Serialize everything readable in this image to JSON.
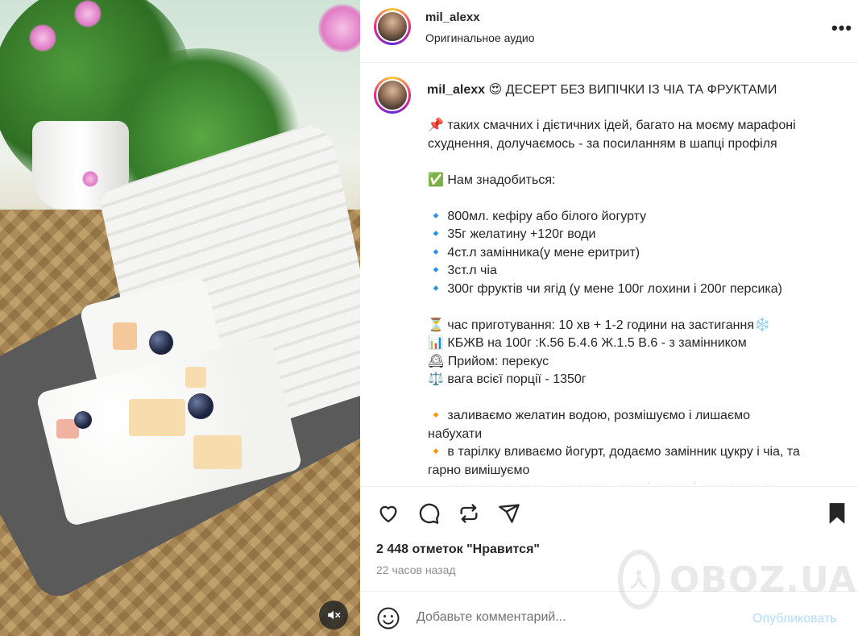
{
  "post": {
    "username": "mil_alexx",
    "audio_label": "Оригинальное аудио",
    "more_glyph": "•••"
  },
  "caption": {
    "username": "mil_alexx",
    "title": "😍 ДЕСЕРТ БЕЗ ВИПІЧКИ ІЗ ЧІА ТА ФРУКТАМИ",
    "lines": [
      "📌 таких смачних і дієтичних ідей, багато на моєму марафоні",
      "схуднення, долучаємось - за посиланням в шапці профіля",
      "",
      "✅ Нам знадобиться:",
      "",
      "🔹 800мл. кефіру або білого йогурту",
      "🔹 35г желатину +120г води",
      "🔹 4ст.л замінника(у мене еритрит)",
      "🔹 3ст.л чіа",
      "🔹 300г фруктів чи ягід (у мене 100г лохини і 200г персика)",
      "",
      "⏳ час приготування: 10 хв + 1-2 години на застигання❄️",
      "📊 КБЖВ на 100г :К.56 Б.4.6 Ж.1.5 В.6 - з замінником",
      "🕰 Прийом: перекус",
      "⚖️ вага всієї порції - 1350г",
      "",
      "🔸 заливаємо желатин водою, розмішуємо і лишаємо",
      "набухати",
      "🔸 в тарілку вливаємо йогурт, додаємо замінник цукру і чіа, та",
      "гарно вимішуємо",
      "🔸 ставимо на вогонь желатин, розмішуємо і доводимо до"
    ]
  },
  "stats": {
    "likes": "2 448 отметок \"Нравится\"",
    "time_ago": "22 часов назад"
  },
  "comment": {
    "placeholder": "Добавьте комментарий...",
    "publish_label": "Опубликовать"
  },
  "watermark": {
    "text": "OBOZ.UA"
  },
  "colors": {
    "text": "#262626",
    "muted": "#8e8e8e",
    "publish_disabled": "#b3dbff",
    "border": "#efefef"
  },
  "icons": [
    "mute-icon",
    "heart-icon",
    "comment-icon",
    "repost-icon",
    "share-icon",
    "bookmark-icon",
    "emoji-icon",
    "more-icon"
  ]
}
